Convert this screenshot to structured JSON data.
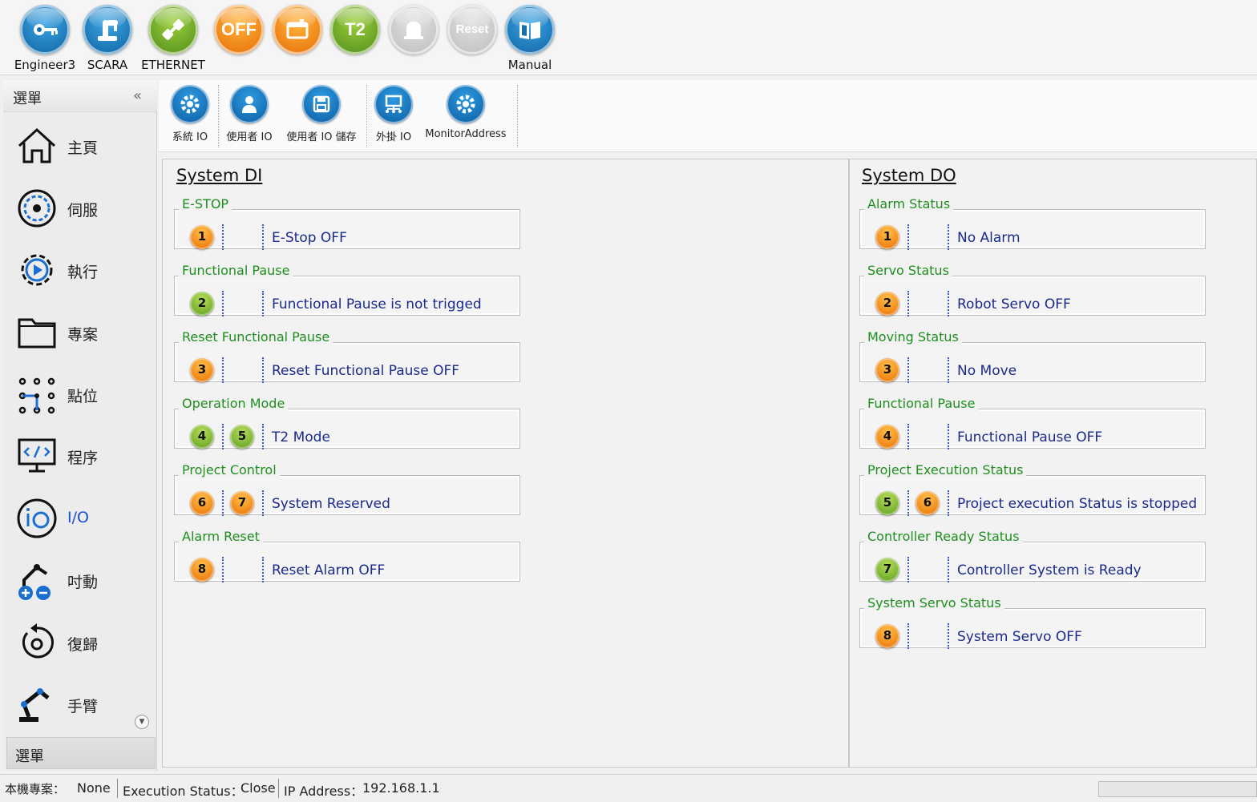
{
  "toolbar": {
    "buttons": [
      {
        "label": "Engineer3",
        "icon": "key-icon",
        "text": ""
      },
      {
        "label": "SCARA",
        "icon": "robot-arm-icon",
        "text": ""
      },
      {
        "label": "ETHERNET",
        "icon": "ethernet-plug-icon",
        "text": ""
      },
      {
        "label": "",
        "icon": "off-icon",
        "text": "OFF"
      },
      {
        "label": "",
        "icon": "folder-window-icon",
        "text": ""
      },
      {
        "label": "",
        "icon": "t2-mode-icon",
        "text": "T2"
      },
      {
        "label": "",
        "icon": "alarm-bell-icon",
        "text": ""
      },
      {
        "label": "",
        "icon": "reset-icon",
        "text": "Reset"
      },
      {
        "label": "Manual",
        "icon": "book-icon",
        "text": ""
      }
    ]
  },
  "sidebar": {
    "title": "選單",
    "collapse_icon": "«",
    "footer": "選單",
    "items": [
      {
        "label": "主頁",
        "icon": "home-icon"
      },
      {
        "label": "伺服",
        "icon": "servo-icon"
      },
      {
        "label": "執行",
        "icon": "run-gear-icon"
      },
      {
        "label": "專案",
        "icon": "folder-icon"
      },
      {
        "label": "點位",
        "icon": "points-icon"
      },
      {
        "label": "程序",
        "icon": "code-monitor-icon"
      },
      {
        "label": "I/O",
        "icon": "io-icon",
        "active": true
      },
      {
        "label": "吋動",
        "icon": "jog-icon"
      },
      {
        "label": "復歸",
        "icon": "homing-icon"
      },
      {
        "label": "手臂",
        "icon": "arm-icon"
      }
    ]
  },
  "subtoolbar": {
    "buttons": [
      {
        "label": "系統 IO",
        "icon": "gear-icon"
      },
      {
        "label": "使用者 IO",
        "icon": "user-icon"
      },
      {
        "label": "使用者 IO 儲存",
        "icon": "save-icon"
      },
      {
        "label": "外掛 IO",
        "icon": "network-icon"
      },
      {
        "label": "MonitorAddress",
        "icon": "gear-icon"
      }
    ]
  },
  "system_di": {
    "title": "System DI",
    "groups": [
      {
        "label": "E-STOP",
        "pins": [
          {
            "n": "1",
            "color": "orange"
          }
        ],
        "text": "E-Stop OFF"
      },
      {
        "label": "Functional Pause",
        "pins": [
          {
            "n": "2",
            "color": "green"
          }
        ],
        "text": "Functional Pause is not trigged"
      },
      {
        "label": "Reset Functional Pause",
        "pins": [
          {
            "n": "3",
            "color": "orange"
          }
        ],
        "text": "Reset Functional Pause OFF"
      },
      {
        "label": "Operation Mode",
        "pins": [
          {
            "n": "4",
            "color": "green"
          },
          {
            "n": "5",
            "color": "green"
          }
        ],
        "text": "T2 Mode"
      },
      {
        "label": "Project Control",
        "pins": [
          {
            "n": "6",
            "color": "orange"
          },
          {
            "n": "7",
            "color": "orange"
          }
        ],
        "text": "System Reserved"
      },
      {
        "label": "Alarm Reset",
        "pins": [
          {
            "n": "8",
            "color": "orange"
          }
        ],
        "text": "Reset Alarm OFF"
      }
    ]
  },
  "system_do": {
    "title": "System DO",
    "groups": [
      {
        "label": "Alarm Status",
        "pins": [
          {
            "n": "1",
            "color": "orange"
          }
        ],
        "text": "No Alarm"
      },
      {
        "label": "Servo Status",
        "pins": [
          {
            "n": "2",
            "color": "orange"
          }
        ],
        "text": "Robot Servo OFF"
      },
      {
        "label": "Moving Status",
        "pins": [
          {
            "n": "3",
            "color": "orange"
          }
        ],
        "text": "No Move"
      },
      {
        "label": "Functional Pause",
        "pins": [
          {
            "n": "4",
            "color": "orange"
          }
        ],
        "text": "Functional Pause OFF"
      },
      {
        "label": "Project Execution Status",
        "pins": [
          {
            "n": "5",
            "color": "green"
          },
          {
            "n": "6",
            "color": "orange"
          }
        ],
        "text": "Project execution Status is stopped"
      },
      {
        "label": "Controller Ready Status",
        "pins": [
          {
            "n": "7",
            "color": "green"
          }
        ],
        "text": "Controller System is Ready"
      },
      {
        "label": "System Servo Status",
        "pins": [
          {
            "n": "8",
            "color": "orange"
          }
        ],
        "text": "System Servo OFF"
      }
    ]
  },
  "status_bar": {
    "project_label": "本機專案：",
    "project_value": "None",
    "execution_label": "Execution Status：",
    "execution_value": "Close",
    "ip_label": "IP Address：",
    "ip_value": "192.168.1.1"
  },
  "colors": {
    "group_label": "#1e8f1e",
    "status_text": "#1a2a8a",
    "pin_on": "#5a9a1c",
    "pin_off": "#e86b00",
    "button_blue": "#0d5f9e"
  }
}
